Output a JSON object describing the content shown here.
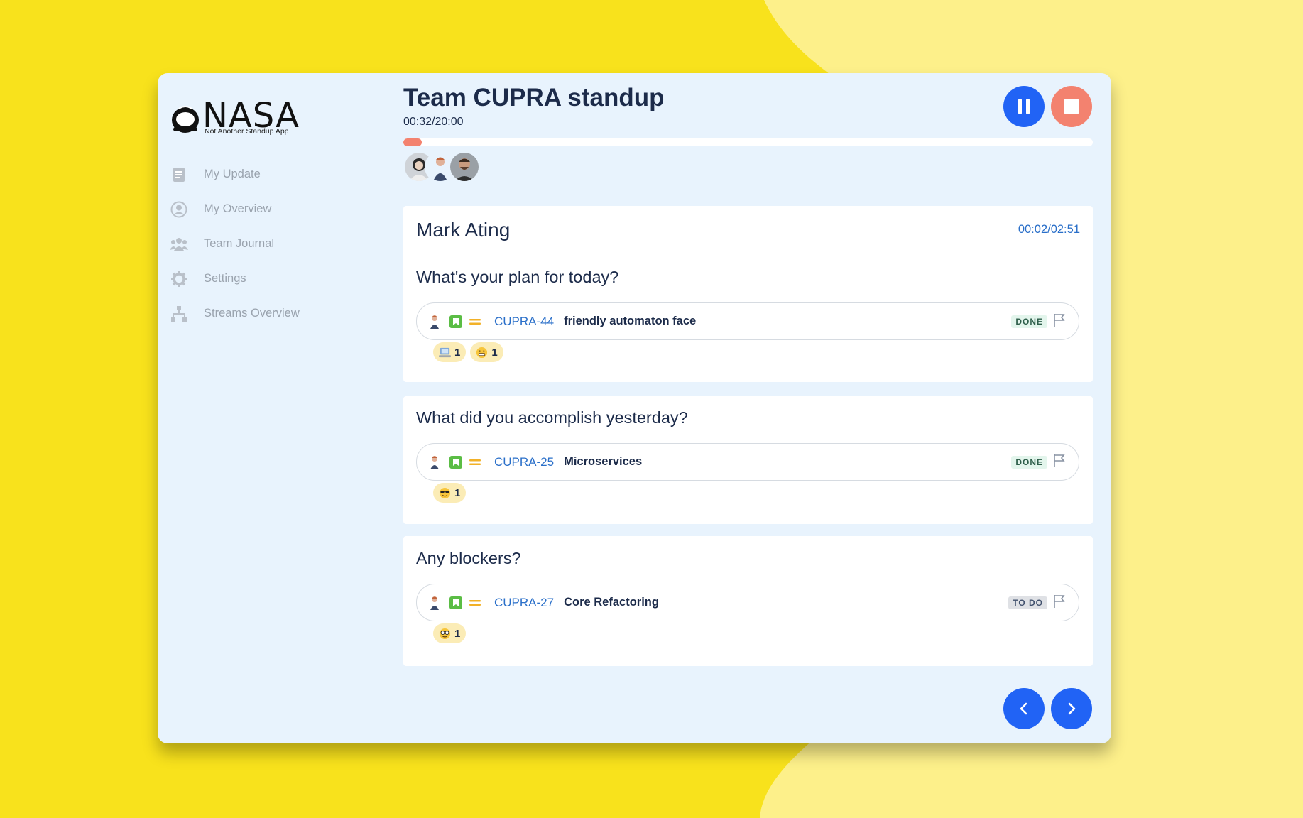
{
  "app": {
    "logo_word": "NASA",
    "logo_tagline": "Not Another Standup App"
  },
  "sidebar": {
    "items": [
      {
        "label": "My Update",
        "icon": "document-icon"
      },
      {
        "label": "My Overview",
        "icon": "user-circle-icon"
      },
      {
        "label": "Team Journal",
        "icon": "team-icon"
      },
      {
        "label": "Settings",
        "icon": "gear-icon"
      },
      {
        "label": "Streams Overview",
        "icon": "hierarchy-icon"
      }
    ]
  },
  "header": {
    "title": "Team CUPRA standup",
    "timer": "00:32/20:00",
    "progress_fraction": 0.027
  },
  "current_speaker": {
    "name": "Mark Ating",
    "timer": "00:02/02:51"
  },
  "sections": [
    {
      "question": "What's your plan for today?",
      "issue": {
        "key": "CUPRA-44",
        "summary": "friendly automaton face",
        "status": "DONE"
      },
      "reactions": [
        {
          "emoji": "computer-emoji",
          "count": "1"
        },
        {
          "emoji": "grin-emoji",
          "count": "1"
        }
      ]
    },
    {
      "question": "What did you accomplish yesterday?",
      "issue": {
        "key": "CUPRA-25",
        "summary": "Microservices",
        "status": "DONE"
      },
      "reactions": [
        {
          "emoji": "sunglasses-emoji",
          "count": "1"
        }
      ]
    },
    {
      "question": "Any blockers?",
      "issue": {
        "key": "CUPRA-27",
        "summary": "Core Refactoring",
        "status": "TO DO"
      },
      "reactions": [
        {
          "emoji": "nerd-emoji",
          "count": "1"
        }
      ]
    }
  ],
  "colors": {
    "background": "#f8e21c",
    "background_light": "#fdf08a",
    "window": "#e8f3fd",
    "primary_blue": "#2163f5",
    "stop_salmon": "#f3826f",
    "link_blue": "#2a6fc9",
    "story_green": "#5bbd45"
  }
}
